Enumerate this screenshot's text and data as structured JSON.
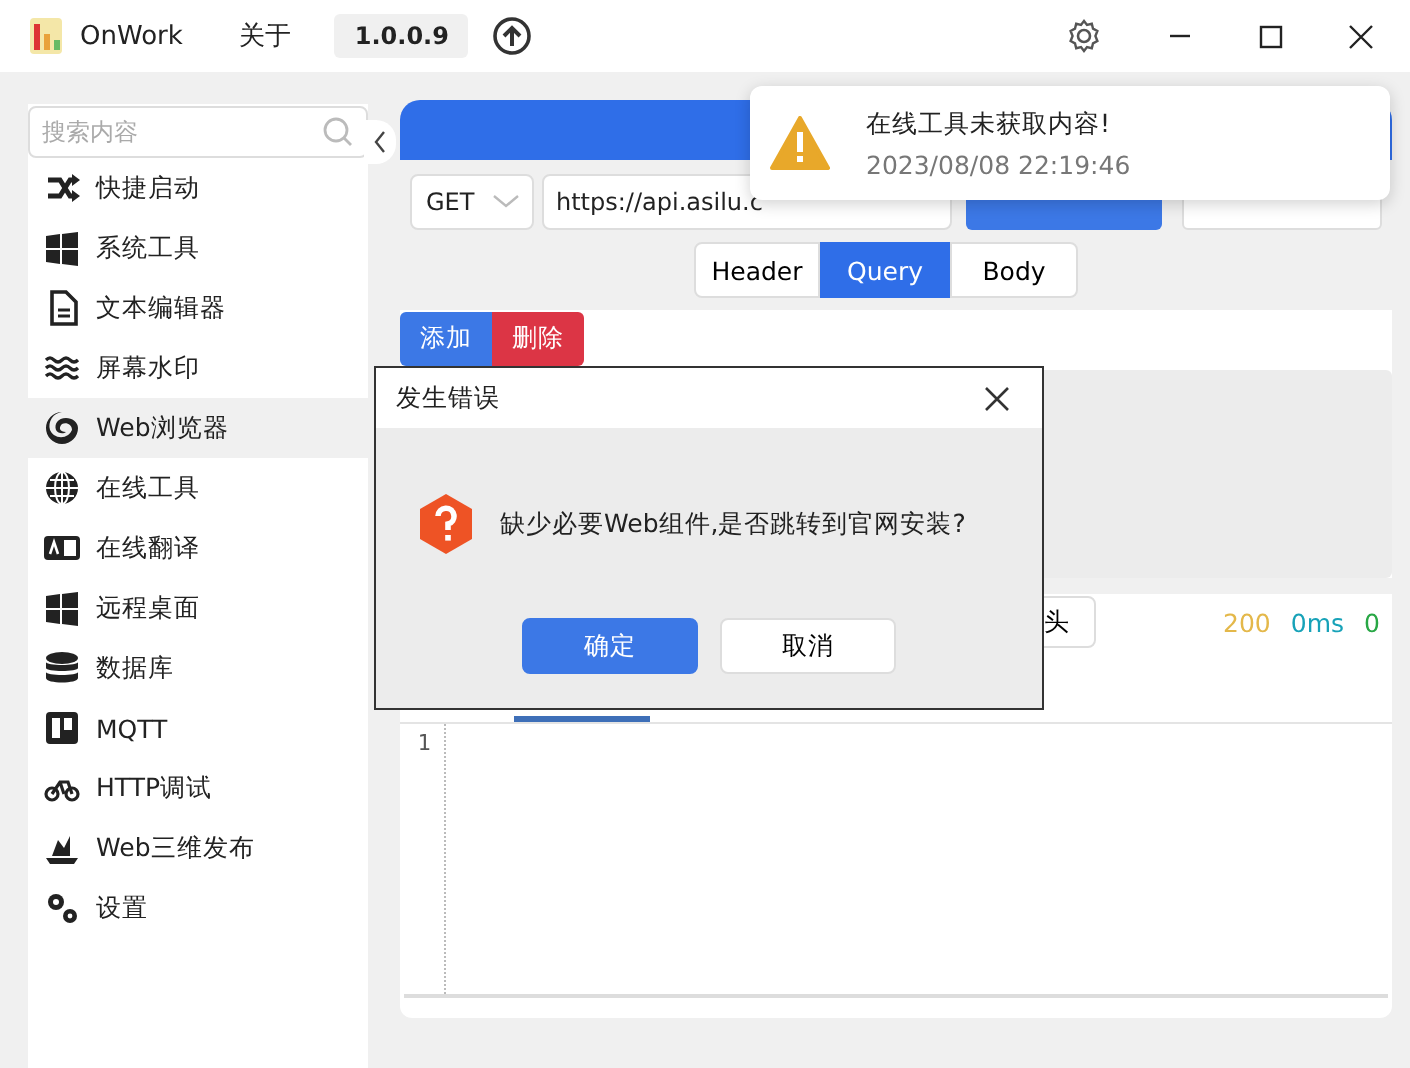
{
  "window": {
    "app_name": "OnWork",
    "menu": "关于",
    "version": "1.0.0.9"
  },
  "sidebar": {
    "search": {
      "placeholder": "搜索内容"
    },
    "items": [
      {
        "label": "快捷启动",
        "kind": "shuffle",
        "selected": false
      },
      {
        "label": "系统工具",
        "kind": "windows",
        "selected": false
      },
      {
        "label": "文本编辑器",
        "kind": "file",
        "selected": false
      },
      {
        "label": "屏幕水印",
        "kind": "waves",
        "selected": false
      },
      {
        "label": "Web浏览器",
        "kind": "browser",
        "selected": true
      },
      {
        "label": "在线工具",
        "kind": "globe",
        "selected": false
      },
      {
        "label": "在线翻译",
        "kind": "translate",
        "selected": false
      },
      {
        "label": "远程桌面",
        "kind": "windows",
        "selected": false
      },
      {
        "label": "数据库",
        "kind": "database",
        "selected": false
      },
      {
        "label": "MQTT",
        "kind": "board",
        "selected": false
      },
      {
        "label": "HTTP调试",
        "kind": "bike",
        "selected": false
      },
      {
        "label": "Web三维发布",
        "kind": "ship",
        "selected": false
      },
      {
        "label": "设置",
        "kind": "gears",
        "selected": false
      }
    ]
  },
  "request": {
    "method": "GET",
    "url": "https://api.asilu.c",
    "tabs": [
      {
        "label": "Header",
        "selected": false
      },
      {
        "label": "Query",
        "selected": true
      },
      {
        "label": "Body",
        "selected": false
      }
    ],
    "param_buttons": [
      {
        "label": "添加",
        "kind": "primary"
      },
      {
        "label": "删除",
        "kind": "danger"
      }
    ]
  },
  "response": {
    "header_button": "头",
    "status": "200",
    "time": "0ms",
    "size": "0",
    "line_numbers": [
      "1"
    ]
  },
  "dialog": {
    "title": "发生错误",
    "message": "缺少必要Web组件,是否跳转到官网安装?",
    "buttons": [
      {
        "label": "确定",
        "kind": "primary"
      },
      {
        "label": "取消",
        "kind": "default"
      }
    ]
  },
  "toast": {
    "title": "在线工具未获取内容!",
    "time": "2023/08/08 22:19:46"
  }
}
